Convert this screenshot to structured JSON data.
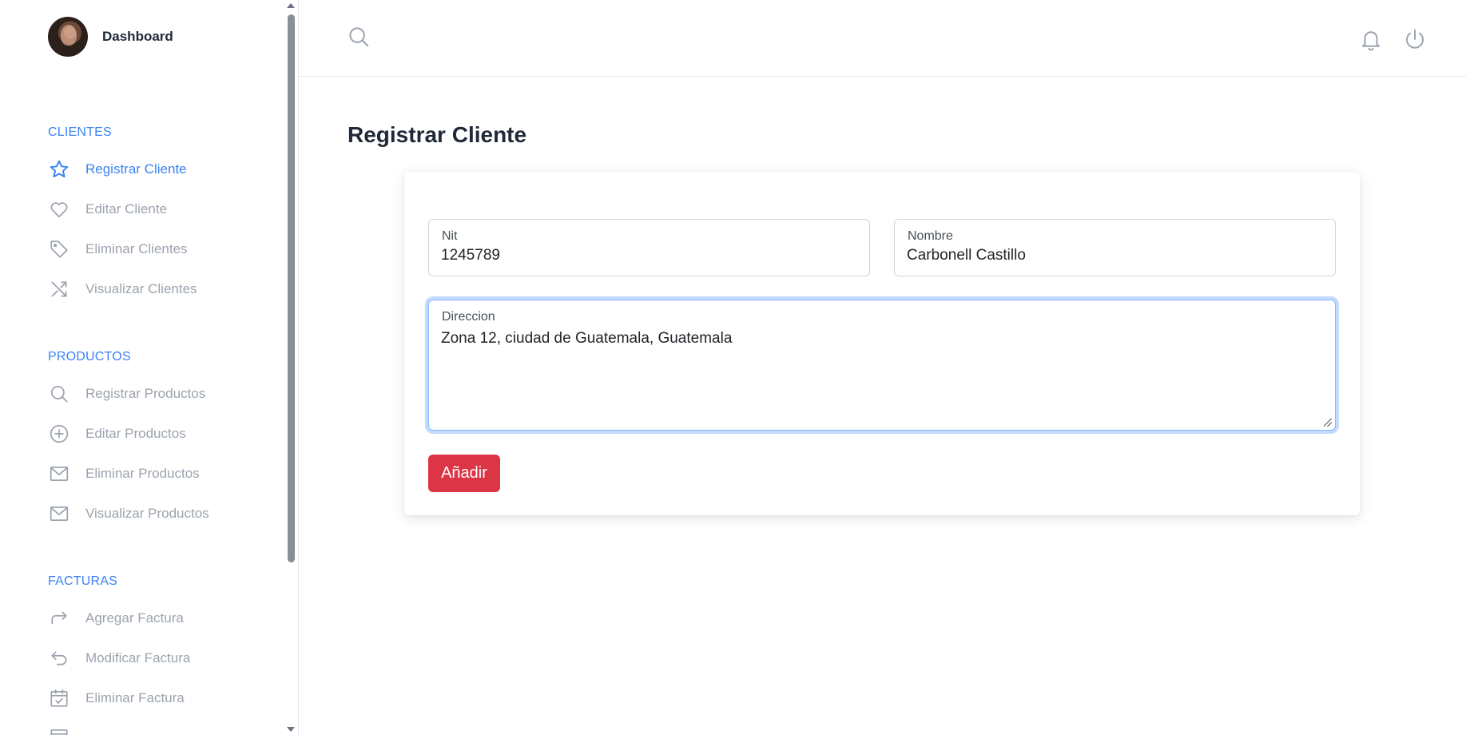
{
  "sidebar": {
    "brand": "Dashboard",
    "sections": [
      {
        "title": "CLIENTES",
        "items": [
          {
            "label": "Registrar Cliente",
            "icon": "star-icon",
            "active": true
          },
          {
            "label": "Editar Cliente",
            "icon": "heart-icon"
          },
          {
            "label": "Eliminar Clientes",
            "icon": "tag-icon"
          },
          {
            "label": "Visualizar Clientes",
            "icon": "shuffle-icon"
          }
        ]
      },
      {
        "title": "PRODUCTOS",
        "items": [
          {
            "label": "Registrar Productos",
            "icon": "search-icon"
          },
          {
            "label": "Editar Productos",
            "icon": "plus-circle-icon"
          },
          {
            "label": "Eliminar Productos",
            "icon": "mail-icon"
          },
          {
            "label": "Visualizar Productos",
            "icon": "mail-icon"
          }
        ]
      },
      {
        "title": "FACTURAS",
        "items": [
          {
            "label": "Agregar Factura",
            "icon": "share-icon"
          },
          {
            "label": "Modificar Factura",
            "icon": "undo-icon"
          },
          {
            "label": "Eliminar Factura",
            "icon": "calendar-check-icon"
          }
        ]
      }
    ]
  },
  "topbar": {
    "icons": [
      "search-icon",
      "bell-icon",
      "power-icon"
    ]
  },
  "main": {
    "title": "Registrar Cliente",
    "form": {
      "nit": {
        "label": "Nit",
        "value": "1245789"
      },
      "nombre": {
        "label": "Nombre",
        "value": "Carbonell Castillo"
      },
      "direccion": {
        "label": "Direccion",
        "value": "Zona 12, ciudad de Guatemala, Guatemala"
      },
      "submit_label": "Añadir"
    }
  },
  "colors": {
    "accent": "#3b82f6",
    "muted": "#9ca3af",
    "danger": "#dc3545"
  }
}
